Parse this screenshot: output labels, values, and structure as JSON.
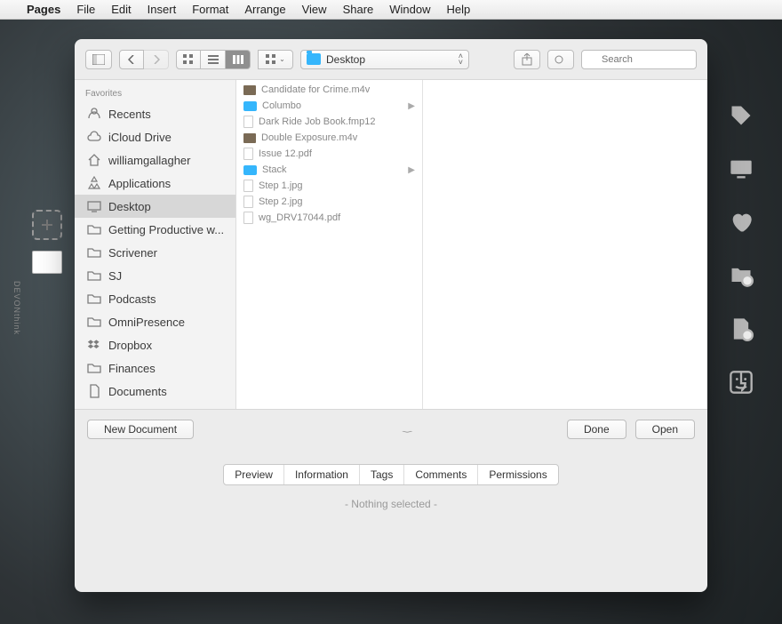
{
  "menubar": {
    "app": "Pages",
    "items": [
      "File",
      "Edit",
      "Insert",
      "Format",
      "Arrange",
      "View",
      "Share",
      "Window",
      "Help"
    ]
  },
  "leftdock": {
    "label": "DEVONthink"
  },
  "toolbar": {
    "crumb_label": "Desktop",
    "search_placeholder": "Search"
  },
  "sidebar": {
    "heading": "Favorites",
    "items": [
      {
        "icon": "recents",
        "label": "Recents"
      },
      {
        "icon": "cloud",
        "label": "iCloud Drive"
      },
      {
        "icon": "home",
        "label": "williamgallagher"
      },
      {
        "icon": "apps",
        "label": "Applications"
      },
      {
        "icon": "desktop",
        "label": "Desktop",
        "selected": true
      },
      {
        "icon": "folder",
        "label": "Getting Productive w..."
      },
      {
        "icon": "folder",
        "label": "Scrivener"
      },
      {
        "icon": "folder",
        "label": "SJ"
      },
      {
        "icon": "folder",
        "label": "Podcasts"
      },
      {
        "icon": "folder",
        "label": "OmniPresence"
      },
      {
        "icon": "dropbox",
        "label": "Dropbox"
      },
      {
        "icon": "folder",
        "label": "Finances"
      },
      {
        "icon": "docs",
        "label": "Documents"
      }
    ]
  },
  "files": [
    {
      "type": "img",
      "name": "Candidate for Crime.m4v"
    },
    {
      "type": "folder",
      "name": "Columbo",
      "hasChildren": true
    },
    {
      "type": "doc",
      "name": "Dark Ride Job Book.fmp12"
    },
    {
      "type": "img",
      "name": "Double Exposure.m4v"
    },
    {
      "type": "doc",
      "name": "Issue 12.pdf"
    },
    {
      "type": "folder",
      "name": "Stack",
      "hasChildren": true
    },
    {
      "type": "doc",
      "name": "Step 1.jpg"
    },
    {
      "type": "doc",
      "name": "Step 2.jpg"
    },
    {
      "type": "doc",
      "name": "wg_DRV17044.pdf"
    }
  ],
  "buttons": {
    "new_doc": "New Document",
    "done": "Done",
    "open": "Open"
  },
  "tabs": [
    "Preview",
    "Information",
    "Tags",
    "Comments",
    "Permissions"
  ],
  "status": "- Nothing selected -"
}
